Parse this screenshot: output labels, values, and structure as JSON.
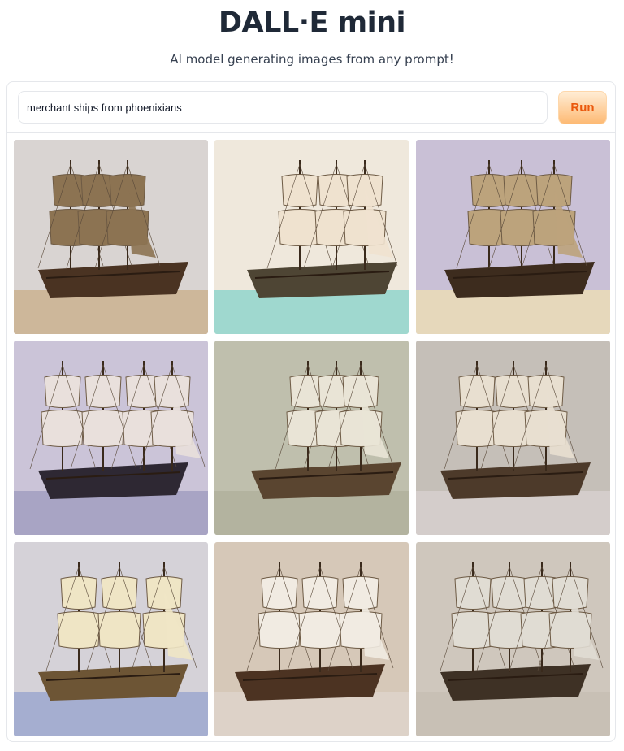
{
  "header": {
    "title": "DALL·E mini",
    "subtitle": "AI model generating images from any prompt!"
  },
  "prompt": {
    "value": "merchant ships from phoenixians",
    "run_label": "Run"
  },
  "gallery": {
    "images": [
      {
        "subject": "ship-image",
        "bg": "#d9d4d2",
        "base": "#cdb79a",
        "hull": "#4a3322",
        "sail": "#8c7352"
      },
      {
        "subject": "ship-image",
        "bg": "#efe8dc",
        "base": "#9fd8cf",
        "hull": "#4e4534",
        "sail": "#efe2cf"
      },
      {
        "subject": "ship-image",
        "bg": "#c9c0d6",
        "base": "#e6d8bb",
        "hull": "#3d2c1e",
        "sail": "#bca37c"
      },
      {
        "subject": "ship-image",
        "bg": "#cbc4d8",
        "base": "#a8a4c4",
        "hull": "#2e2833",
        "sail": "#e9e0dc"
      },
      {
        "subject": "ship-image",
        "bg": "#bfbfad",
        "base": "#b3b39f",
        "hull": "#5a4530",
        "sail": "#e9e4d6"
      },
      {
        "subject": "ship-image",
        "bg": "#c5bfb8",
        "base": "#d4cdcb",
        "hull": "#4d3a2a",
        "sail": "#e8dfd0"
      },
      {
        "subject": "ship-image",
        "bg": "#d5d2d8",
        "base": "#a5aed0",
        "hull": "#6d5535",
        "sail": "#efe5c5"
      },
      {
        "subject": "ship-image",
        "bg": "#d6c8b8",
        "base": "#ddd2c8",
        "hull": "#4c3322",
        "sail": "#f1ebe2"
      },
      {
        "subject": "ship-image",
        "bg": "#cfc7bd",
        "base": "#c8c0b5",
        "hull": "#3e3125",
        "sail": "#e0dcd3"
      }
    ]
  }
}
